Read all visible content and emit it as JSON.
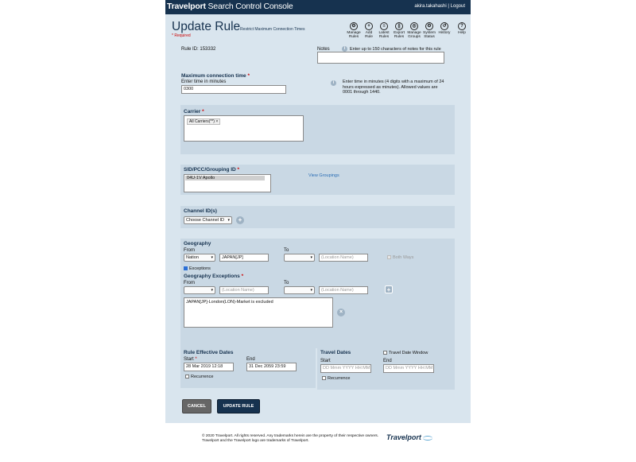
{
  "header": {
    "brand_bold": "Travelport",
    "brand_rest": " Search Control Console",
    "user": "akira.takahashi",
    "separator": " | ",
    "logout": "Logout"
  },
  "page": {
    "title": "Update Rule",
    "subtitle": "- Restrict Maximum Connection Times",
    "required_note": "* Required",
    "rule_id_label": "Rule ID:",
    "rule_id": "153332"
  },
  "toolbar": [
    {
      "name": "manage-rules",
      "glyph": "⚙",
      "label": "Manage\nRules"
    },
    {
      "name": "add-rule",
      "glyph": "+",
      "label": "Add\nRule"
    },
    {
      "name": "latest-rules",
      "glyph": "≡",
      "label": "Latest\nRules"
    },
    {
      "name": "export-rules",
      "glyph": "||",
      "label": "Export\nRules"
    },
    {
      "name": "manage-groups",
      "glyph": "◎",
      "label": "Manage\nGroups"
    },
    {
      "name": "system-status",
      "glyph": "⚙",
      "label": "System\nStatus"
    },
    {
      "name": "history",
      "glyph": "↺",
      "label": "History"
    },
    {
      "name": "help",
      "glyph": "?",
      "label": "Help"
    }
  ],
  "notes": {
    "label": "Notes",
    "hint": "Enter up to 150 characters of notes for this rule",
    "value": ""
  },
  "max_conn": {
    "label": "Maximum connection time",
    "req": "*",
    "sub_label": "Enter time in minutes",
    "value": "0300",
    "help": "Enter time in minutes (4 digits with a maximum of 24 hours expressed as minutes). Allowed values are 0001 through 1440."
  },
  "carrier": {
    "label": "Carrier",
    "req": "*",
    "tag": "All Carriers(**)",
    "tag_remove": "×"
  },
  "sid": {
    "label": "SID/PCC/Grouping ID",
    "req": "*",
    "selected": "04U-1V Apollo",
    "view_link": "View Groupings"
  },
  "channel": {
    "label": "Channel ID(s)",
    "select_value": "Choose Channel ID"
  },
  "geography": {
    "label": "Geography",
    "from_label": "From",
    "to_label": "To",
    "from_type": "Nation",
    "from_value": "JAPAN[JP]",
    "to_type": "",
    "to_placeholder": "(Location Name)",
    "both_ways": "Both Ways",
    "exceptions_label": "Exceptions",
    "exceptions_checked": true
  },
  "geo_exceptions": {
    "label": "Geography Exceptions",
    "req": "*",
    "from_label": "From",
    "to_label": "To",
    "from_placeholder": "(Location Name)",
    "to_placeholder": "(Location Name)",
    "list_item": "JAPAN[JP]-London(LON)-Market is excluded"
  },
  "effective": {
    "label": "Rule Effective Dates",
    "start_label": "Start",
    "req": "*",
    "end_label": "End",
    "start_value": "28 Mar 2019 12:18",
    "end_value": "31 Dec 2059 23:59",
    "recurrence": "Recurrence"
  },
  "travel": {
    "label": "Travel Dates",
    "window_label": "Travel Date Window",
    "start_label": "Start",
    "end_label": "End",
    "start_placeholder": "DD Mmm YYYY HH:MM",
    "end_placeholder": "DD Mmm YYYY HH:MM",
    "recurrence": "Recurrence"
  },
  "buttons": {
    "cancel": "CANCEL",
    "update": "UPDATE RULE"
  },
  "footer": {
    "text": "© 2020 Travelport. All rights reserved. Any trademarks herein are the property of their respective owners. Travelport and the Travelport logo are trademarks of Travelport.",
    "logo": "Travelport"
  },
  "colors": {
    "header_bg": "#16324f",
    "panel_bg": "#d9e5ee",
    "section_bg": "#c9d8e4",
    "required": "#cc0000",
    "link": "#2a6db5"
  }
}
